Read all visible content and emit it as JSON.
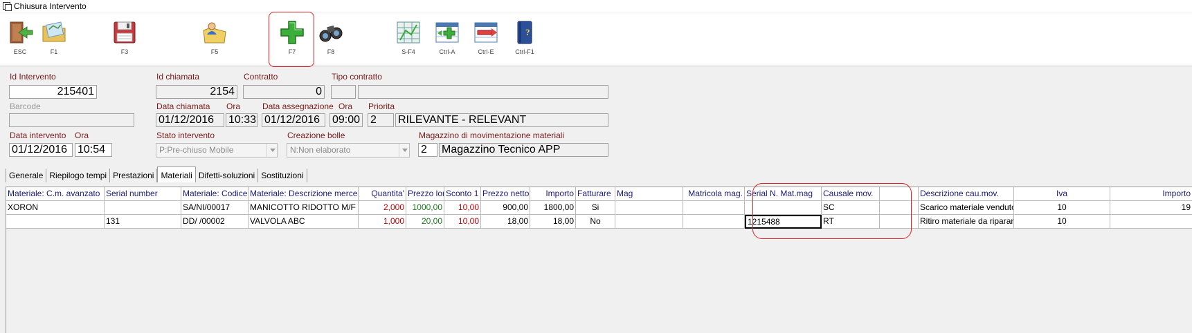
{
  "window": {
    "title": "Chiusura Intervento"
  },
  "toolbar": {
    "buttons": [
      {
        "key": "ESC",
        "icon": "exit-door-icon"
      },
      {
        "key": "F1",
        "icon": "folder-map-icon"
      },
      {
        "key": "F3",
        "icon": "floppy-save-icon"
      },
      {
        "key": "F5",
        "icon": "folder-person-icon"
      },
      {
        "key": "F7",
        "icon": "green-plus-icon"
      },
      {
        "key": "F8",
        "icon": "binoculars-icon"
      },
      {
        "key": "S-F4",
        "icon": "grid-map-icon"
      },
      {
        "key": "Ctrl-A",
        "icon": "add-row-icon"
      },
      {
        "key": "Ctrl-E",
        "icon": "remove-row-icon"
      },
      {
        "key": "Ctrl-F1",
        "icon": "help-book-icon"
      }
    ]
  },
  "form": {
    "id_intervento": {
      "label": "Id Intervento",
      "value": "215401"
    },
    "barcode": {
      "label": "Barcode",
      "value": ""
    },
    "data_intervento": {
      "label": "Data intervento",
      "value": "01/12/2016"
    },
    "ora_intervento": {
      "label": "Ora",
      "value": "10:54"
    },
    "id_chiamata": {
      "label": "Id chiamata",
      "value": "2154"
    },
    "contratto": {
      "label": "Contratto",
      "value": "0"
    },
    "tipo_contratto": {
      "label": "Tipo contratto",
      "code": "",
      "value": ""
    },
    "data_chiamata": {
      "label": "Data chiamata",
      "value": "01/12/2016"
    },
    "ora_chiamata": {
      "label": "Ora",
      "value": "10:33"
    },
    "data_assegnazione": {
      "label": "Data assegnazione",
      "value": "01/12/2016"
    },
    "ora_assegnazione": {
      "label": "Ora",
      "value": "09:00"
    },
    "priorita": {
      "label": "Priorita",
      "code": "2",
      "value": "RILEVANTE - RELEVANT"
    },
    "stato_intervento": {
      "label": "Stato intervento",
      "value": "P:Pre-chiuso Mobile"
    },
    "creazione_bolle": {
      "label": "Creazione bolle",
      "value": "N:Non elaborato"
    },
    "magazzino": {
      "label": "Magazzino di movimentazione materiali",
      "code": "2",
      "value": "Magazzino Tecnico APP"
    }
  },
  "tabs": [
    {
      "label": "Generale",
      "active": false
    },
    {
      "label": "Riepilogo tempi",
      "active": false
    },
    {
      "label": "Prestazioni",
      "active": false
    },
    {
      "label": "Materiali",
      "active": true
    },
    {
      "label": "Difetti-soluzioni",
      "active": false
    },
    {
      "label": "Sostituzioni",
      "active": false
    }
  ],
  "grid": {
    "columns": [
      "Materiale: C.m. avanzato",
      "Serial number",
      "Materiale: Codice",
      "Materiale: Descrizione merce",
      "Quantita'",
      "Prezzo lordo",
      "Sconto 1",
      "Prezzo netto",
      "Importo",
      "Fatturare",
      "Mag",
      "Matricola mag.",
      "Serial N. Mat.mag",
      "Causale mov.",
      "",
      "Descrizione cau.mov.",
      "Iva",
      "Importo"
    ],
    "rows": [
      [
        "XORON",
        "",
        "SA/NI/00017",
        "MANICOTTO RIDOTTO M/F",
        "2,000",
        "1000,00",
        "10,00",
        "900,00",
        "1800,00",
        "Si",
        "",
        "",
        "",
        "SC",
        "",
        "Scarico materiale venduto",
        "10",
        "19"
      ],
      [
        "",
        "131",
        "DD/  /00002",
        "VALVOLA ABC",
        "1,000",
        "20,00",
        "10,00",
        "18,00",
        "18,00",
        "No",
        "",
        "",
        "1215488",
        "RT",
        "",
        "Ritiro materiale da riparare",
        "10",
        ""
      ]
    ]
  }
}
